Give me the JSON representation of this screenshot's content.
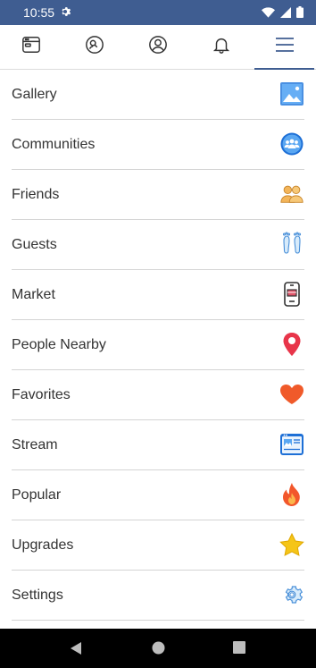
{
  "status_bar": {
    "time": "10:55",
    "icons": [
      "gear-icon",
      "wifi-icon",
      "signal-icon",
      "battery-icon"
    ]
  },
  "tabs": [
    {
      "name": "browser-tab",
      "icon": "browser-window-icon",
      "active": false
    },
    {
      "name": "search-people-tab",
      "icon": "people-search-icon",
      "active": false
    },
    {
      "name": "profile-tab",
      "icon": "profile-icon",
      "active": false
    },
    {
      "name": "notifications-tab",
      "icon": "bell-icon",
      "active": false
    },
    {
      "name": "menu-tab",
      "icon": "hamburger-menu-icon",
      "active": true
    }
  ],
  "menu": {
    "items": [
      {
        "label": "Gallery",
        "icon": "gallery-icon"
      },
      {
        "label": "Communities",
        "icon": "communities-icon"
      },
      {
        "label": "Friends",
        "icon": "friends-icon"
      },
      {
        "label": "Guests",
        "icon": "footprints-icon"
      },
      {
        "label": "Market",
        "icon": "market-phone-icon"
      },
      {
        "label": "People Nearby",
        "icon": "location-pin-icon"
      },
      {
        "label": "Favorites",
        "icon": "heart-icon"
      },
      {
        "label": "Stream",
        "icon": "stream-icon"
      },
      {
        "label": "Popular",
        "icon": "fire-icon"
      },
      {
        "label": "Upgrades",
        "icon": "star-icon"
      },
      {
        "label": "Settings",
        "icon": "settings-gear-icon"
      }
    ]
  },
  "nav_bar": {
    "buttons": [
      "back-icon",
      "home-icon",
      "recents-icon"
    ]
  },
  "colors": {
    "status_bar": "#3f5d91",
    "accent": "#3f5d91",
    "text": "#333333",
    "divider": "#d4d4d4"
  }
}
